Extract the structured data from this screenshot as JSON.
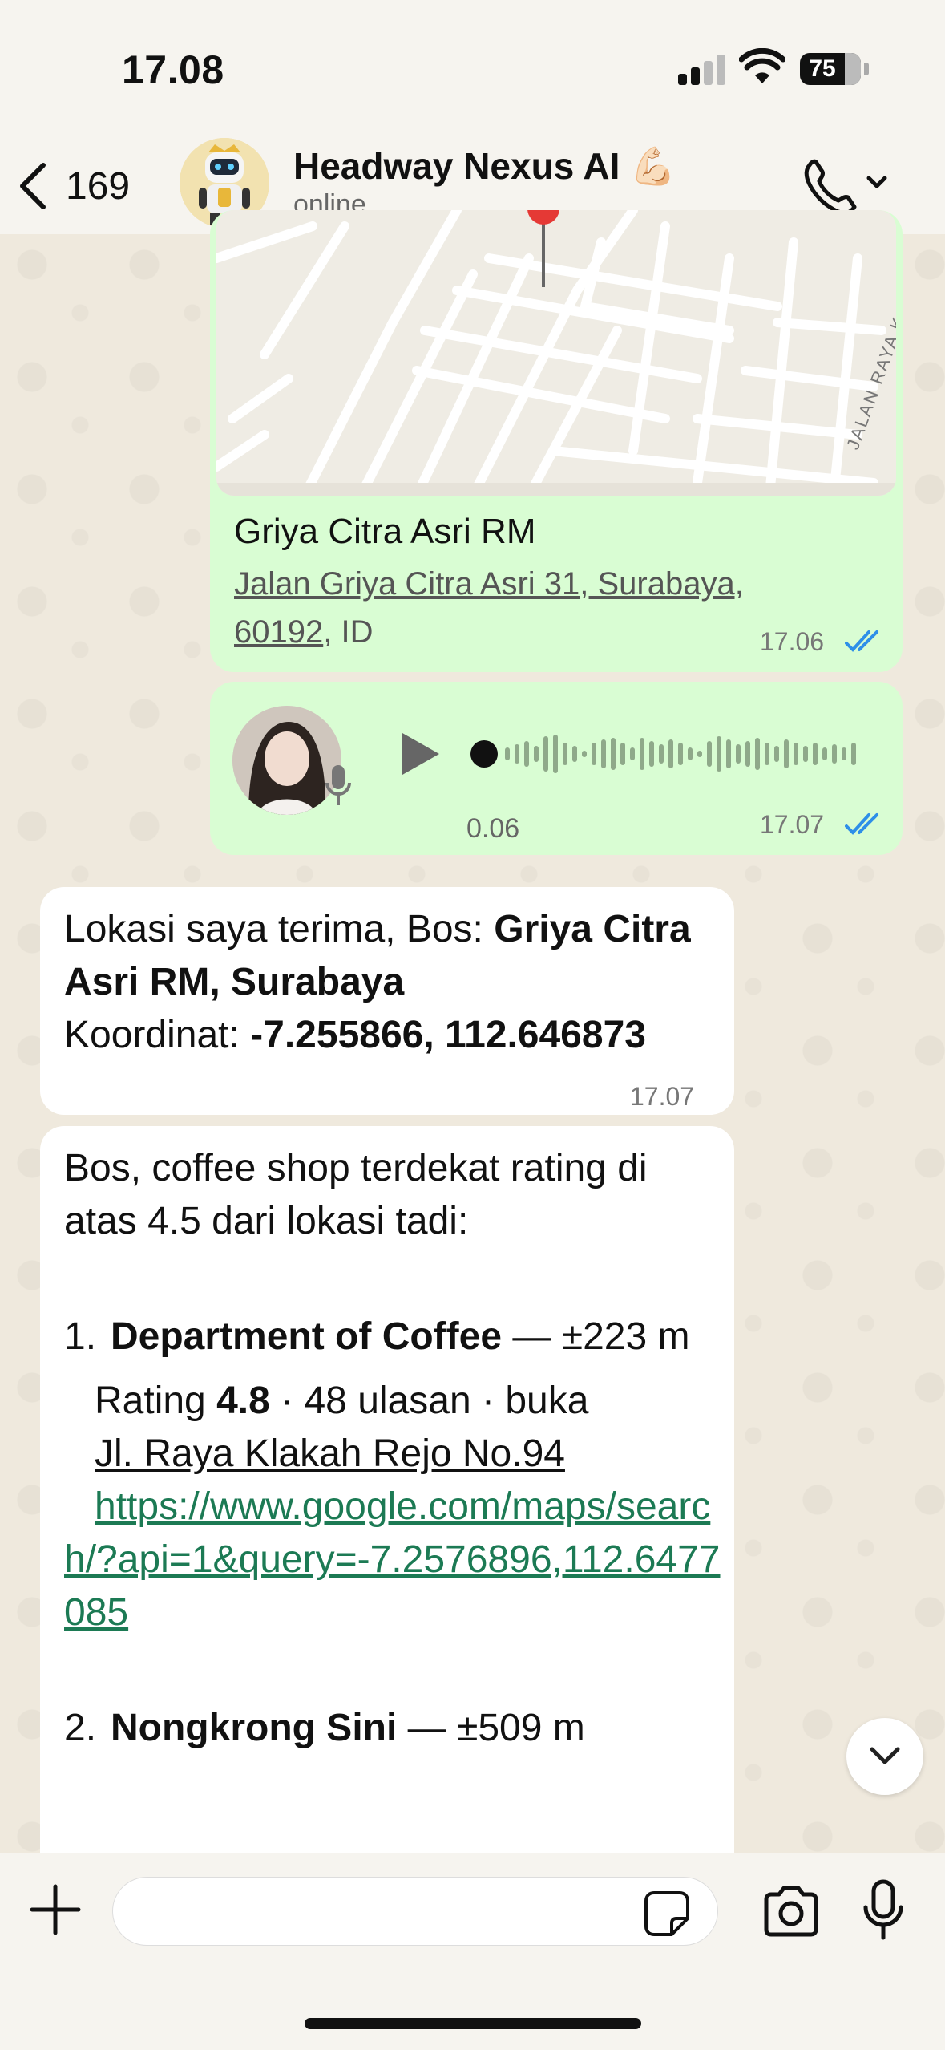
{
  "status_bar": {
    "time": "17.08",
    "battery_percent": 75,
    "battery_label": "75"
  },
  "header": {
    "back_count": "169",
    "contact_name": "Headway Nexus AI 💪🏻",
    "contact_status": "online"
  },
  "messages": {
    "location": {
      "place_name": "Griya Citra Asri RM",
      "address_link": "Jalan Griya Citra Asri 31, Surabaya, 60192",
      "address_suffix": ", ID",
      "map_street_label": "JALAN RAYA K...",
      "time": "17.06"
    },
    "voice": {
      "duration": "0.06",
      "time": "17.07"
    },
    "reply1": {
      "line1_prefix": "Lokasi saya terima, Bos: ",
      "line1_bold": "Griya Citra Asri RM, Surabaya",
      "line2_prefix": "Koordinat: ",
      "line2_bold": "-7.255866, 112.646873",
      "time": "17.07"
    },
    "reply2": {
      "intro": "Bos, coffee shop terdekat rating di atas 4.5 dari lokasi tadi:",
      "item1_num": "1.",
      "item1_name": "Department of Coffee",
      "item1_dist": " — ±223 m",
      "item1_rating_prefix": "Rating ",
      "item1_rating_value": "4.8",
      "item1_rating_suffix": " · 48 ulasan · buka",
      "item1_address": "Jl. Raya Klakah Rejo No.94",
      "item1_link": "https://www.google.com/maps/search/?api=1&query=-7.2576896,112.6477085",
      "item2_num": "2.",
      "item2_name": "Nongkrong Sini",
      "item2_dist": " — ±509 m"
    }
  },
  "input": {
    "placeholder": ""
  },
  "colors": {
    "outgoing_bubble": "#d9fdd3",
    "incoming_bubble": "#ffffff",
    "link": "#1c7a54",
    "read_ticks": "#2e8fe8"
  }
}
